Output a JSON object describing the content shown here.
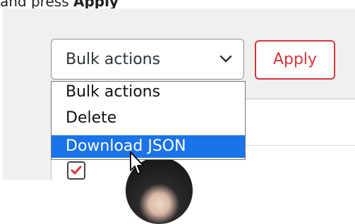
{
  "top_text": {
    "prefix": "and press ",
    "bold": "Apply"
  },
  "bulk_select": {
    "selected_label": "Bulk actions",
    "options": [
      {
        "label": "Bulk actions",
        "selected": false
      },
      {
        "label": "Delete",
        "selected": false
      },
      {
        "label": "Download JSON",
        "selected": true
      }
    ]
  },
  "apply_button": {
    "label": "Apply"
  },
  "colors": {
    "accent": "#d63638",
    "panel_bg": "#f0f0f1",
    "highlight": "#1a73e8",
    "border": "#8c8f94"
  },
  "icons": {
    "select_chevron": "chevron-down-icon",
    "row_checkbox": "checkbox-checked-icon",
    "pointer": "mouse-cursor-icon"
  },
  "row_checkbox_checked": true
}
